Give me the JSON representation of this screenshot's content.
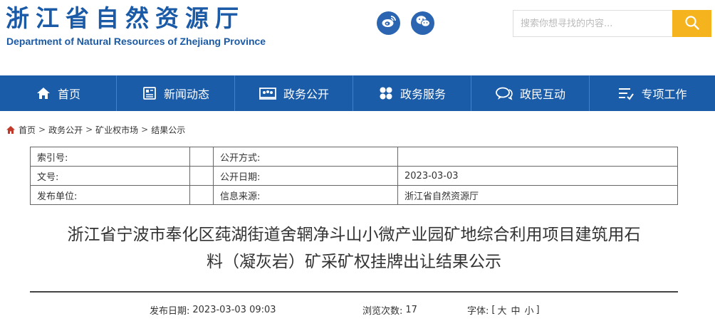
{
  "header": {
    "title_cn": "浙江省自然资源厅",
    "title_en": "Department of Natural Resources of Zhejiang Province",
    "social": [
      {
        "name": "weibo-icon"
      },
      {
        "name": "wechat-icon"
      }
    ],
    "search": {
      "placeholder": "搜索你想寻找的内容..."
    }
  },
  "nav": {
    "items": [
      {
        "label": "首页",
        "icon": "home-icon"
      },
      {
        "label": "新闻动态",
        "icon": "news-icon"
      },
      {
        "label": "政务公开",
        "icon": "gov-open-icon"
      },
      {
        "label": "政务服务",
        "icon": "service-icon"
      },
      {
        "label": "政民互动",
        "icon": "chat-icon"
      },
      {
        "label": "专项工作",
        "icon": "task-list-icon"
      }
    ]
  },
  "breadcrumb": {
    "items": [
      "首页",
      "政务公开",
      "矿业权市场",
      "结果公示"
    ],
    "separator": ">"
  },
  "info_table": {
    "rows": [
      {
        "label1": "索引号:",
        "value1": "",
        "label2": "公开方式:",
        "value2": ""
      },
      {
        "label1": "文号:",
        "value1": "",
        "label2": "公开日期:",
        "value2": "2023-03-03"
      },
      {
        "label1": "发布单位:",
        "value1": "",
        "label2": "信息来源:",
        "value2": "浙江省自然资源厅"
      }
    ]
  },
  "article": {
    "title_line1": "浙江省宁波市奉化区莼湖街道舍辋净斗山小微产业园矿地综合利用项目建筑用石",
    "title_line2": "料（凝灰岩）矿采矿权挂牌出让结果公示",
    "publish_label": "发布日期:",
    "publish_date": "2023-03-03 09:03",
    "views_label": "浏览次数:",
    "views_count": "17",
    "font_label": "字体:",
    "font_open": "[",
    "font_large": "大",
    "font_medium": "中",
    "font_small": "小",
    "font_close": "]"
  },
  "colors": {
    "brand_blue": "#1b5ca8",
    "search_button": "#f5b31e"
  }
}
